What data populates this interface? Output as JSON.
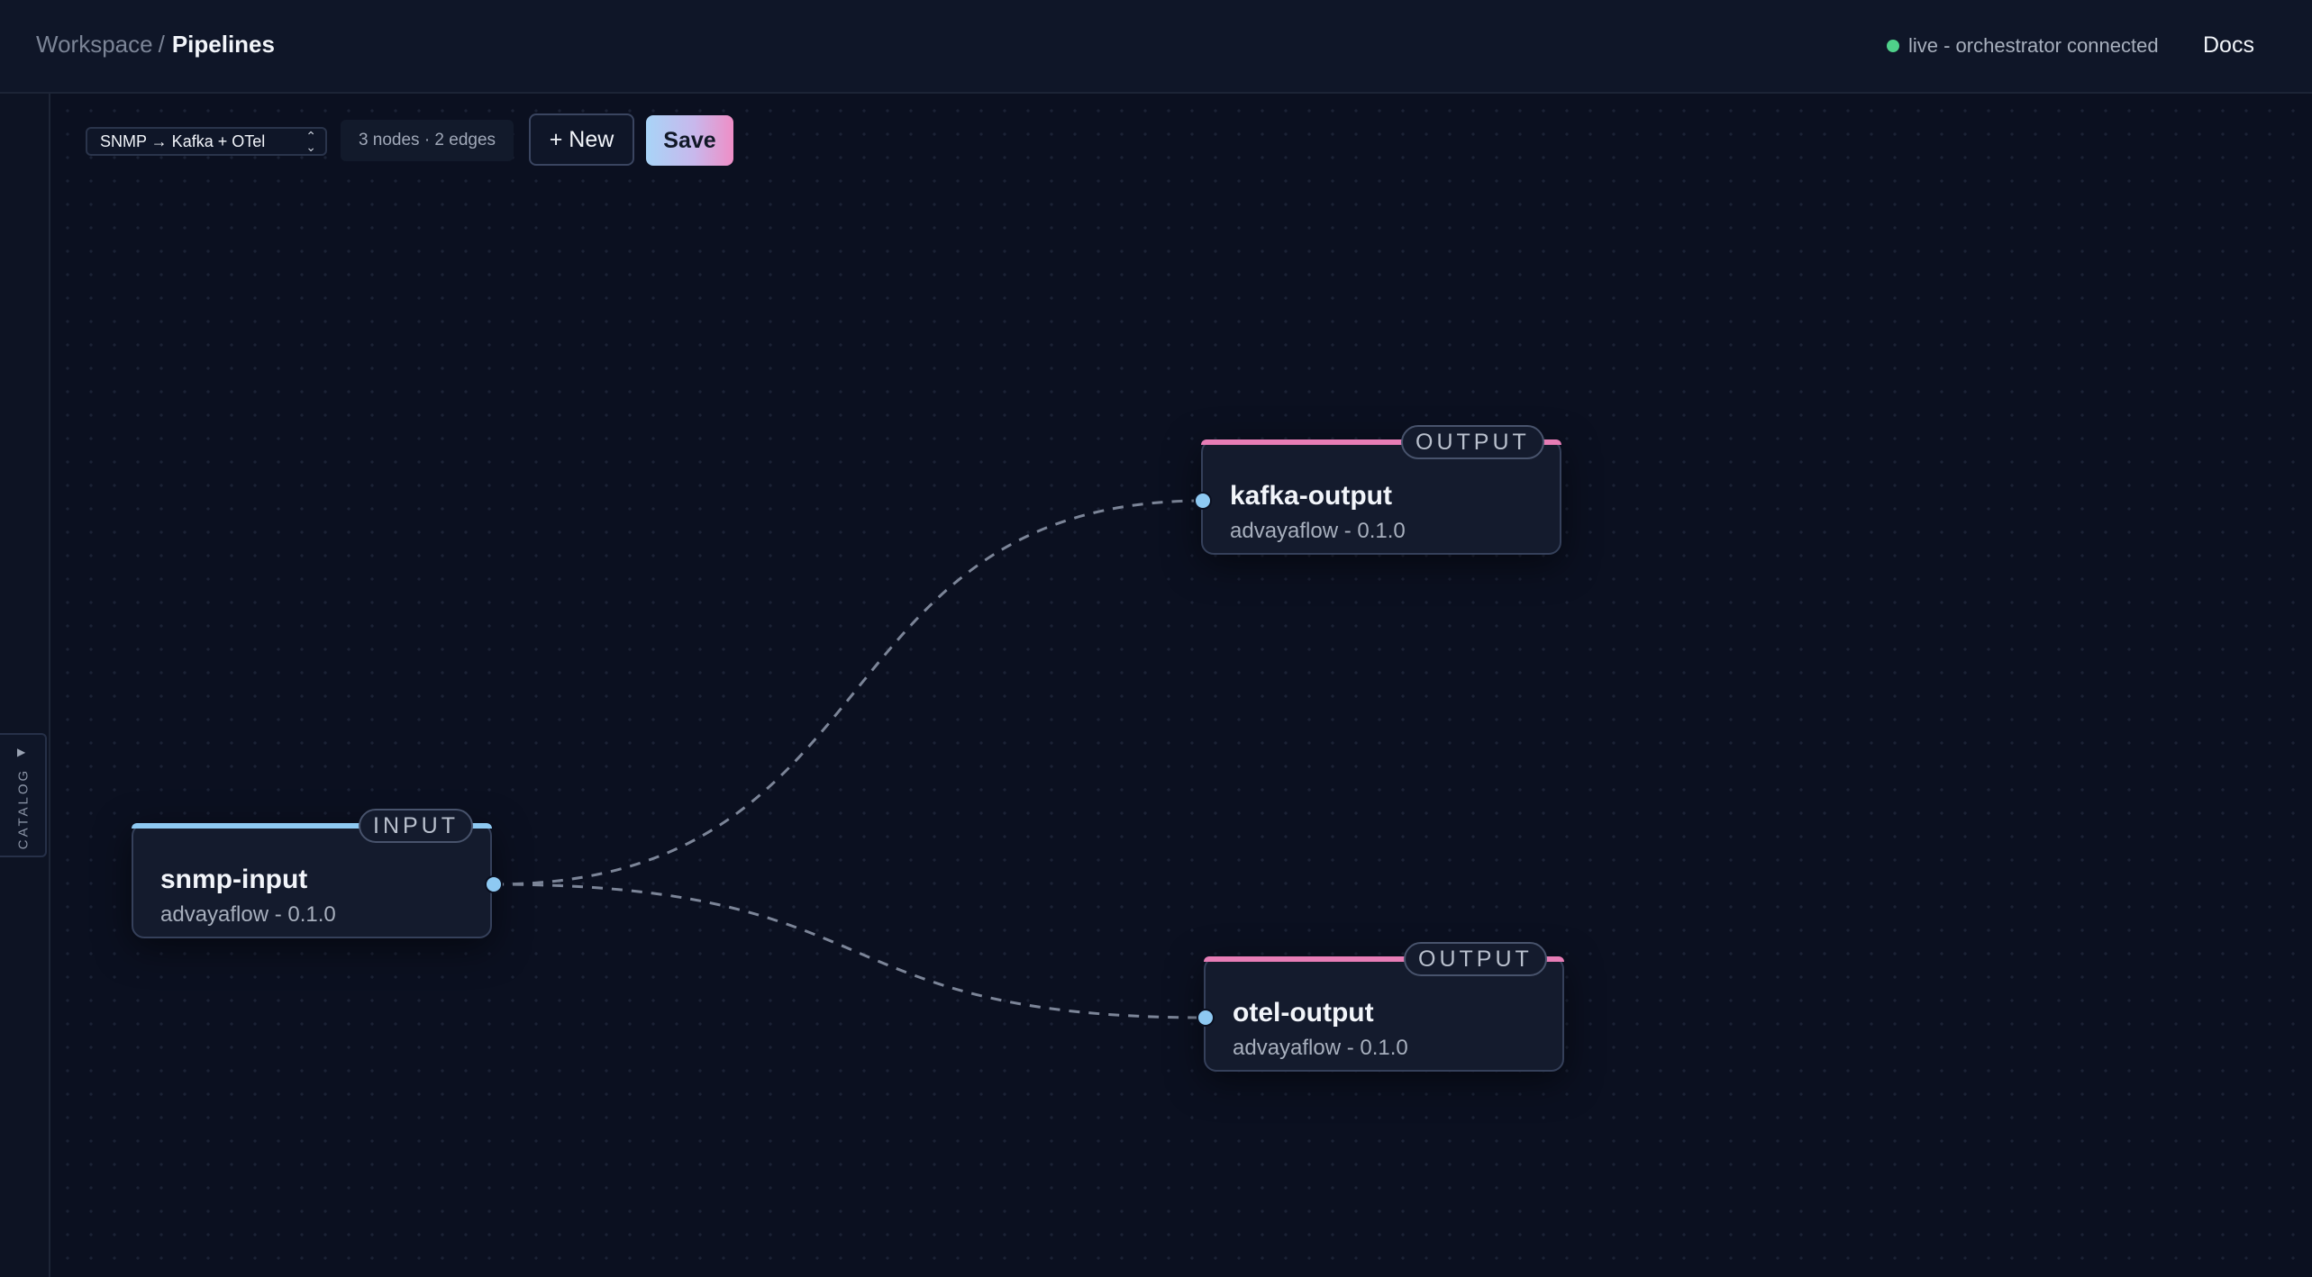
{
  "header": {
    "breadcrumb_root": "Workspace",
    "breadcrumb_separator": "/",
    "breadcrumb_current": "Pipelines",
    "status_text": "live - orchestrator connected",
    "status_color": "#4fd08a",
    "docs_label": "Docs"
  },
  "sidebar": {
    "catalog_label": "CATALOG",
    "catalog_arrow_icon": "triangle-right-icon"
  },
  "toolbar": {
    "pipeline_selected": "SNMP → Kafka + OTel",
    "stats": "3 nodes · 2 edges",
    "new_label": "+ New",
    "save_label": "Save"
  },
  "nodes": [
    {
      "id": "snmp-input",
      "kind": "INPUT",
      "title": "snmp-input",
      "subtitle": "advayaflow - 0.1.0",
      "accent": "#8ec9f2"
    },
    {
      "id": "kafka-output",
      "kind": "OUTPUT",
      "title": "kafka-output",
      "subtitle": "advayaflow - 0.1.0",
      "accent": "#e77db6"
    },
    {
      "id": "otel-output",
      "kind": "OUTPUT",
      "title": "otel-output",
      "subtitle": "advayaflow - 0.1.0",
      "accent": "#e77db6"
    }
  ],
  "edges": [
    {
      "from": "snmp-input",
      "to": "kafka-output"
    },
    {
      "from": "snmp-input",
      "to": "otel-output"
    }
  ]
}
